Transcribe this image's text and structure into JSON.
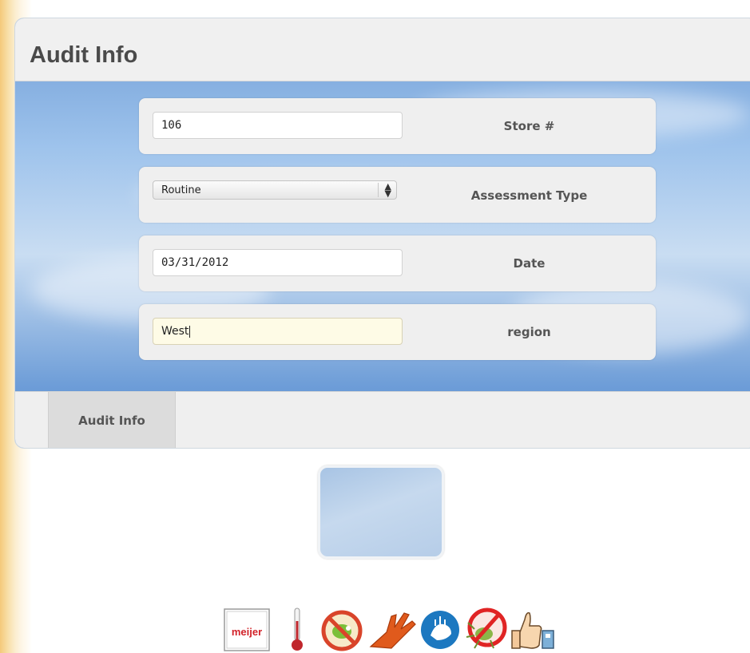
{
  "header": {
    "title": "Audit Info"
  },
  "fields": [
    {
      "value": "106",
      "label": "Store #"
    },
    {
      "value": "Routine",
      "label": "Assessment Type"
    },
    {
      "value": "03/31/2012",
      "label": "Date"
    },
    {
      "value": "West",
      "label": "region"
    }
  ],
  "tabs": [
    {
      "label": "Audit Info"
    }
  ],
  "footer_icons": {
    "logo_text": "meijer",
    "icons": [
      "meijer-logo-icon",
      "thermometer-icon",
      "no-pests-icon",
      "glove-icon",
      "handwash-icon",
      "no-bugs-icon",
      "thumbs-up-icon"
    ]
  },
  "colors": {
    "title_bar": "#f0f0f0",
    "active_input": "#fefbe6",
    "tab_active": "#dcdcdc"
  }
}
